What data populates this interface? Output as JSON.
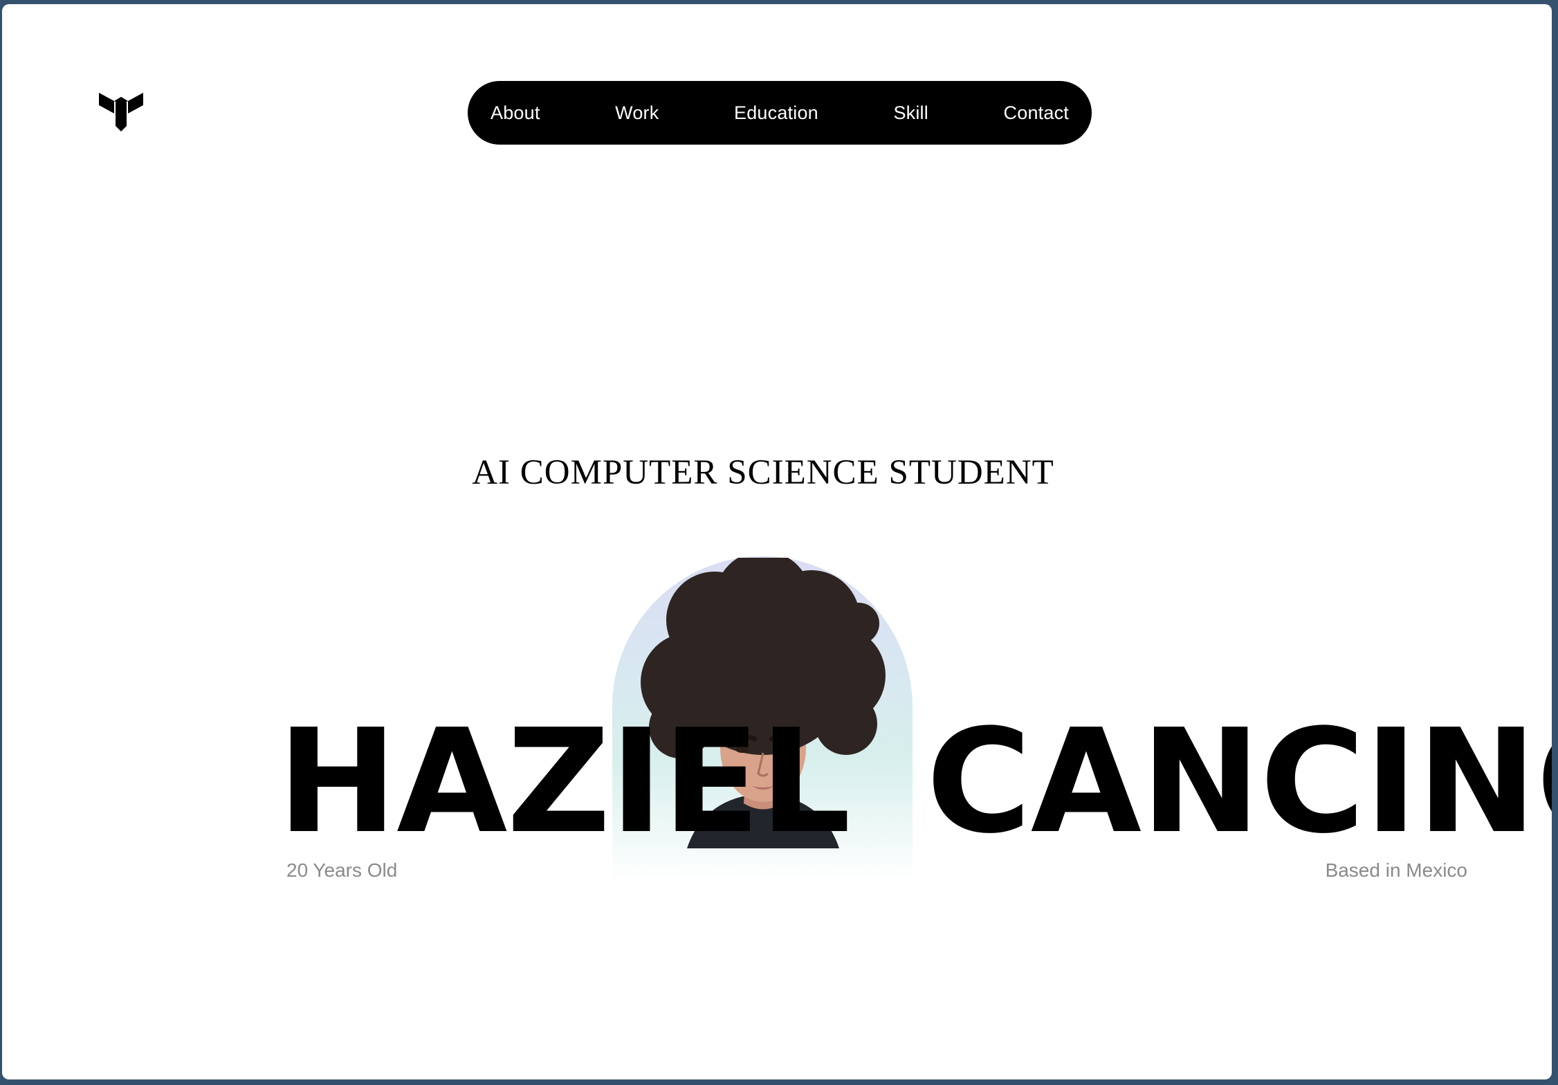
{
  "nav": {
    "items": [
      "About",
      "Work",
      "Education",
      "Skill",
      "Contact"
    ]
  },
  "hero": {
    "subtitle": "AI COMPUTER SCIENCE STUDENT",
    "first_name": "HAZIEL",
    "last_name": "CANCINO",
    "age": "20 Years Old",
    "location": "Based in Mexico"
  },
  "icons": {
    "logo": "logo-mark-icon",
    "portrait": "profile-portrait"
  },
  "colors": {
    "nav_bg": "#000000",
    "nav_text": "#ffffff",
    "meta_text": "#8a8a8a",
    "portrait_gradient_top": "#dadcf3",
    "portrait_gradient_mid": "#d7efec"
  }
}
